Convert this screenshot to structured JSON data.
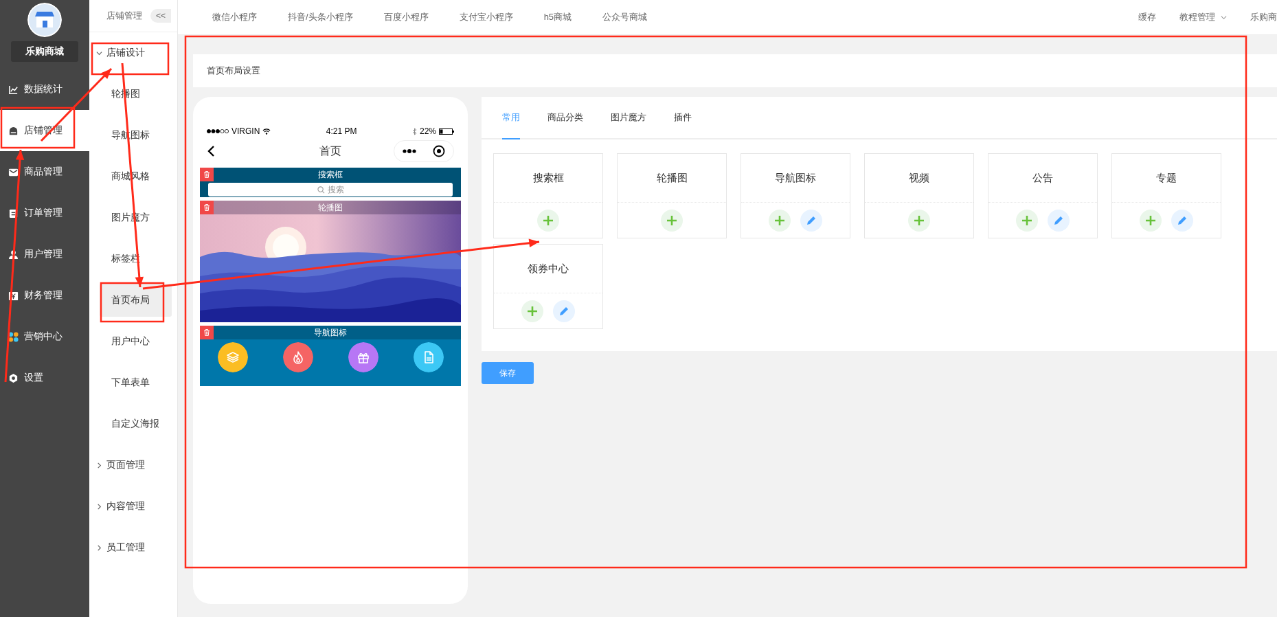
{
  "brand": {
    "name": "乐购商城"
  },
  "sidebar": {
    "items": [
      {
        "label": "数据统计",
        "kind": "chart",
        "selected": false
      },
      {
        "label": "店铺管理",
        "kind": "store",
        "selected": true
      },
      {
        "label": "商品管理",
        "kind": "mail",
        "selected": false
      },
      {
        "label": "订单管理",
        "kind": "clipboard",
        "selected": false
      },
      {
        "label": "用户管理",
        "kind": "user",
        "selected": false
      },
      {
        "label": "财务管理",
        "kind": "money",
        "selected": false
      },
      {
        "label": "营销中心",
        "kind": "marketing",
        "selected": false
      },
      {
        "label": "设置",
        "kind": "settings",
        "selected": false
      }
    ]
  },
  "subnav": {
    "title": "店铺管理",
    "collapse": "<<",
    "groups": [
      {
        "label": "店铺设计",
        "expanded": true,
        "children": [
          {
            "label": "轮播图",
            "selected": false
          },
          {
            "label": "导航图标",
            "selected": false
          },
          {
            "label": "商城风格",
            "selected": false
          },
          {
            "label": "图片魔方",
            "selected": false
          },
          {
            "label": "标签栏",
            "selected": false
          },
          {
            "label": "首页布局",
            "selected": true
          },
          {
            "label": "用户中心",
            "selected": false
          },
          {
            "label": "下单表单",
            "selected": false
          },
          {
            "label": "自定义海报",
            "selected": false
          }
        ]
      },
      {
        "label": "页面管理",
        "expanded": false
      },
      {
        "label": "内容管理",
        "expanded": false
      },
      {
        "label": "员工管理",
        "expanded": false
      }
    ]
  },
  "topbar": {
    "tabs": [
      "微信小程序",
      "抖音/头条小程序",
      "百度小程序",
      "支付宝小程序",
      "h5商城",
      "公众号商城"
    ],
    "right": [
      {
        "label": "缓存",
        "dropdown": false
      },
      {
        "label": "教程管理",
        "dropdown": true
      },
      {
        "label": "乐购商",
        "dropdown": false
      }
    ]
  },
  "page": {
    "title": "首页布局设置"
  },
  "phone": {
    "carrier": "VIRGIN",
    "time": "4:21 PM",
    "battery": "22%",
    "title": "首页",
    "modules": [
      {
        "kind": "search",
        "label": "搜索框",
        "placeholder": "搜索"
      },
      {
        "kind": "carousel",
        "label": "轮播图"
      },
      {
        "kind": "nav",
        "label": "导航图标",
        "icons": [
          {
            "kind": "layers",
            "color": "#fbbd23"
          },
          {
            "kind": "fire",
            "color": "#f56464"
          },
          {
            "kind": "gift",
            "color": "#b777f5"
          },
          {
            "kind": "document",
            "color": "#3cc8f5"
          }
        ]
      }
    ]
  },
  "panel": {
    "tabs": [
      {
        "label": "常用",
        "selected": true
      },
      {
        "label": "商品分类",
        "selected": false
      },
      {
        "label": "图片魔方",
        "selected": false
      },
      {
        "label": "插件",
        "selected": false
      }
    ],
    "components": [
      {
        "title": "搜索框",
        "actions": [
          {
            "kind": "add"
          }
        ]
      },
      {
        "title": "轮播图",
        "actions": [
          {
            "kind": "add"
          }
        ]
      },
      {
        "title": "导航图标",
        "actions": [
          {
            "kind": "add"
          },
          {
            "kind": "edit"
          }
        ]
      },
      {
        "title": "视频",
        "actions": [
          {
            "kind": "add"
          }
        ]
      },
      {
        "title": "公告",
        "actions": [
          {
            "kind": "add"
          },
          {
            "kind": "edit"
          }
        ]
      },
      {
        "title": "专题",
        "actions": [
          {
            "kind": "add"
          },
          {
            "kind": "edit"
          }
        ]
      },
      {
        "title": "领券中心",
        "actions": [
          {
            "kind": "add"
          },
          {
            "kind": "edit"
          }
        ]
      }
    ]
  },
  "save_button": "保存"
}
